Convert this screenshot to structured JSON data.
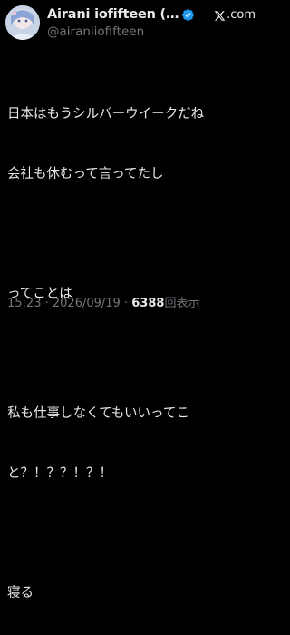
{
  "colors": {
    "background": "#000000",
    "text_primary": "#e7e9ea",
    "text_secondary": "#71767b",
    "verified": "#1d9bf0"
  },
  "author": {
    "display_name": "Airani iofifteen (…",
    "handle": "@airaniiofifteen",
    "verified_icon": "verified-badge-icon",
    "avatar_icon": "avatar-image"
  },
  "brand": {
    "icon": "x-logo-icon",
    "text": ".com"
  },
  "post": {
    "lines": [
      "日本はもうシルバーウイークだね",
      "会社も休むって言ってたし",
      "",
      "ってことは",
      "",
      "私も仕事しなくてもいいってこ",
      "と？！？？！？！",
      "",
      "寝る"
    ]
  },
  "meta": {
    "time": "15:23",
    "separator": "·",
    "date": "2026/09/19",
    "views_count": "6388",
    "views_label": "回表示"
  }
}
